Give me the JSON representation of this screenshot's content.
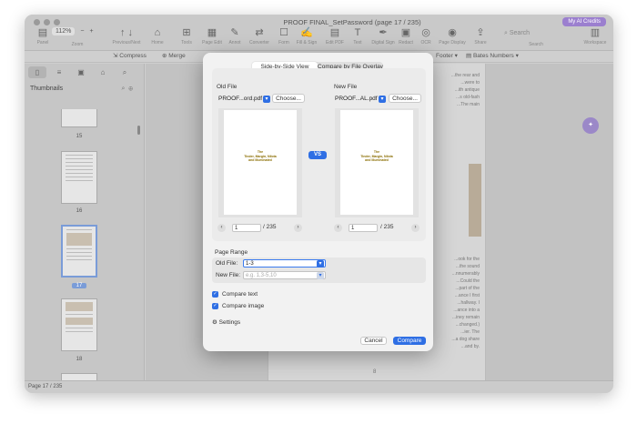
{
  "window": {
    "title": "PROOF FINAL_SetPassword (page 17 / 235)",
    "ai_credits": "My AI Credits"
  },
  "toolbar": {
    "zoom": "112%",
    "zoom_minus": "−",
    "zoom_plus": "+",
    "search_placeholder": "Search",
    "items": [
      {
        "icon": "↶",
        "label": "Panel"
      },
      {
        "label": "Zoom"
      },
      {
        "icon": "↑",
        "label": "Previous/Next"
      },
      {
        "icon": "⌂",
        "label": "Home"
      },
      {
        "icon": "⊞",
        "label": "Tools"
      },
      {
        "icon": "✎",
        "label": "Page Edit"
      },
      {
        "icon": "✎",
        "label": "Annot"
      },
      {
        "icon": "⇄",
        "label": "Converter"
      },
      {
        "icon": "☐",
        "label": "Form"
      },
      {
        "icon": "✍",
        "label": "Fill & Sign"
      },
      {
        "icon": "▤",
        "label": "Edit PDF"
      },
      {
        "icon": "T",
        "label": "Text"
      },
      {
        "icon": "✒",
        "label": "Digital Sign"
      },
      {
        "icon": "✂",
        "label": "Redact"
      },
      {
        "icon": "◎",
        "label": "OCR"
      },
      {
        "icon": "◉",
        "label": "Page Display"
      },
      {
        "icon": "⇪",
        "label": "Share"
      },
      {
        "icon": "⌕",
        "label": "Search"
      },
      {
        "icon": "▥",
        "label": "Workspace"
      }
    ]
  },
  "subbar": {
    "compress": "Compress",
    "merge": "Merge",
    "footer": "Footer",
    "bates": "Bates Numbers"
  },
  "sidebar": {
    "title": "Thumbnails",
    "pages": [
      "15",
      "16",
      "17",
      "18"
    ]
  },
  "document": {
    "page_number": "8",
    "lines_top": [
      "...the rear and",
      "...were to",
      "...ith antique",
      "...s old-fash",
      "...The main"
    ],
    "lines_bottom": [
      "...ook for the",
      "...the sound",
      "...nnumerably",
      "...Could the",
      "...part of the",
      "...ance I first",
      "...hallway. I",
      "...ance into a",
      "...iney remain",
      "...changed.)",
      "...ier. The",
      "...a dog share",
      "...and by."
    ]
  },
  "statusbar": {
    "page_info": "Page 17 / 235"
  },
  "dialog": {
    "tabs": [
      "Side-by-Side View",
      "Compare by File Overlay"
    ],
    "old_file": {
      "label": "Old File",
      "name": "PROOF...ord.pdf",
      "choose": "Choose...",
      "page": "1",
      "total": "/ 235",
      "preview_title": [
        "The",
        "Tinder, Margin, Nilota",
        "and Illuminated"
      ]
    },
    "new_file": {
      "label": "New File",
      "name": "PROOF...AL.pdf",
      "choose": "Choose...",
      "page": "1",
      "total": "/ 235",
      "preview_title": [
        "The",
        "Tinder, Margin, Nilota",
        "and Illuminated"
      ]
    },
    "vs_label": "VS",
    "page_range": {
      "title": "Page Range",
      "old_label": "Old File:",
      "old_value": "1-3",
      "new_label": "New File:",
      "new_placeholder": "e.g. 1,3-5,10"
    },
    "compare_text": "Compare text",
    "compare_image": "Compare image",
    "settings": "Settings",
    "cancel": "Cancel",
    "compare": "Compare"
  }
}
